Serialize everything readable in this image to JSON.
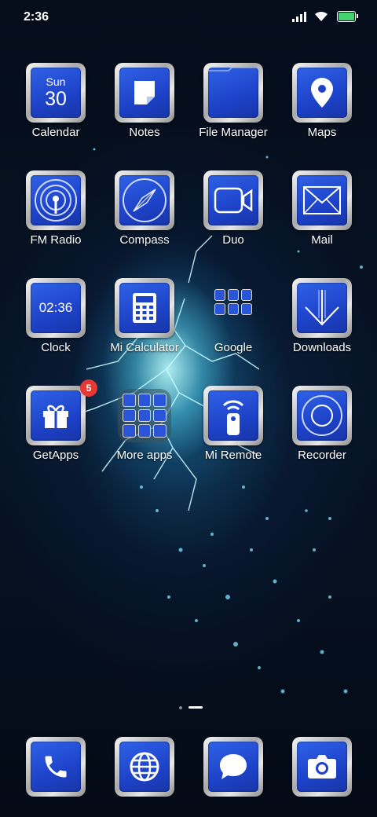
{
  "status_bar": {
    "time": "2:36",
    "icons": [
      "signal-icon",
      "wifi-icon",
      "battery-icon"
    ],
    "battery_color": "#43d26b"
  },
  "accent_colors": {
    "tile_blue": "#1d42c8",
    "tile_frame": "#c8c8c8",
    "badge_red": "#e53935"
  },
  "rows": [
    [
      {
        "label": "Calendar",
        "icon": "calendar-icon",
        "day": "Sun",
        "date": "30"
      },
      {
        "label": "Notes",
        "icon": "notes-icon"
      },
      {
        "label": "File Manager",
        "icon": "folder-icon"
      },
      {
        "label": "Maps",
        "icon": "map-pin-icon"
      }
    ],
    [
      {
        "label": "FM Radio",
        "icon": "radio-icon"
      },
      {
        "label": "Compass",
        "icon": "compass-icon"
      },
      {
        "label": "Duo",
        "icon": "video-camera-icon"
      },
      {
        "label": "Mail",
        "icon": "mail-icon"
      }
    ],
    [
      {
        "label": "Clock",
        "icon": "clock-icon",
        "clock_text": "02:36"
      },
      {
        "label": "Mi Calculator",
        "icon": "calculator-icon"
      },
      {
        "label": "Google",
        "icon": "folder-grid-icon"
      },
      {
        "label": "Downloads",
        "icon": "download-arrow-icon"
      }
    ],
    [
      {
        "label": "GetApps",
        "icon": "gift-icon",
        "badge": "5"
      },
      {
        "label": "More apps",
        "icon": "folder-grid-icon"
      },
      {
        "label": "Mi Remote",
        "icon": "remote-icon"
      },
      {
        "label": "Recorder",
        "icon": "record-icon"
      }
    ]
  ],
  "dock": [
    {
      "icon": "phone-icon"
    },
    {
      "icon": "globe-icon"
    },
    {
      "icon": "message-icon"
    },
    {
      "icon": "camera-icon"
    }
  ],
  "page_indicator": {
    "pages": 2,
    "current": 2
  }
}
